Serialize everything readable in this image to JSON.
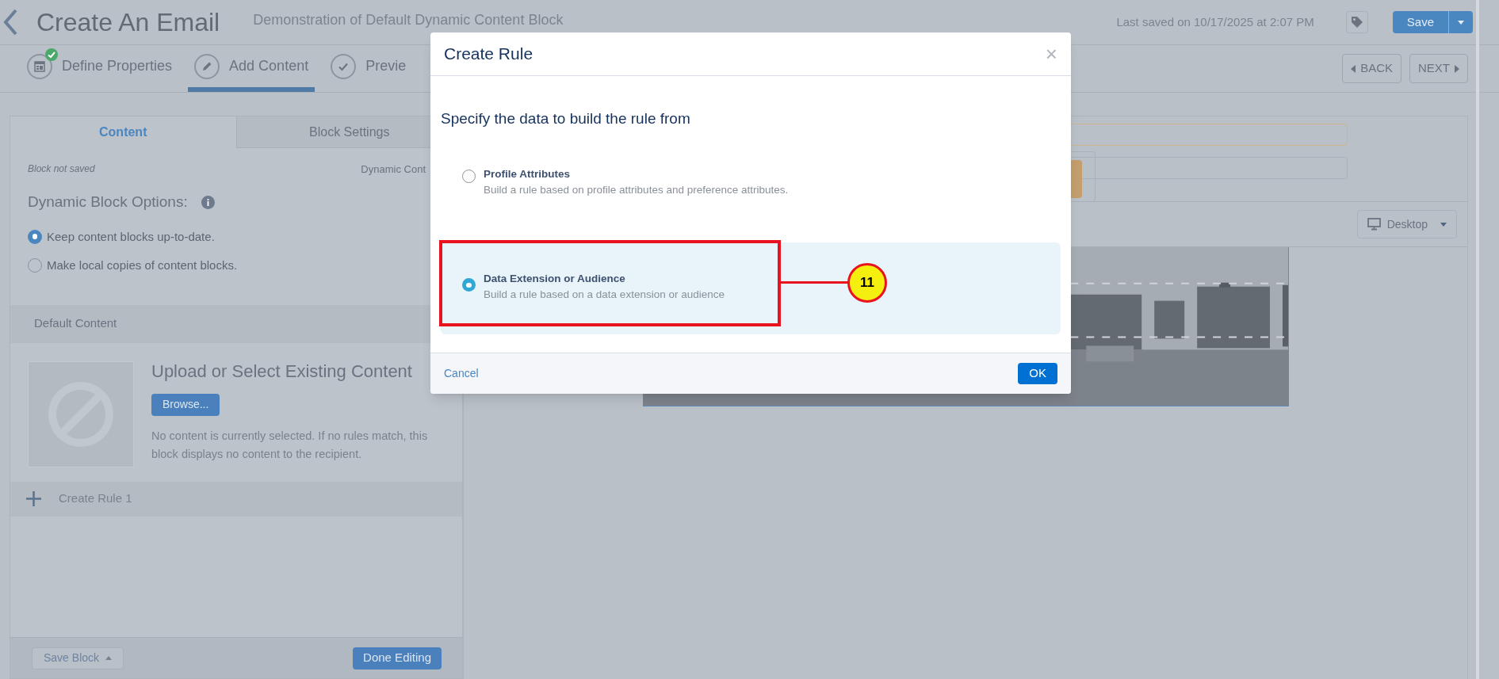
{
  "header": {
    "title": "Create An Email",
    "subtitle": "Demonstration of Default Dynamic Content Block",
    "last_saved": "Last saved on 10/17/2025 at 2:07 PM",
    "save": "Save"
  },
  "steps": [
    {
      "kind": "properties",
      "label": "Define Properties",
      "selected": false,
      "done": true
    },
    {
      "kind": "content",
      "label": "Add Content",
      "selected": true,
      "done": false
    },
    {
      "kind": "preview",
      "label": "Previe",
      "selected": false,
      "done": false
    }
  ],
  "nav": {
    "back": "BACK",
    "next": "NEXT"
  },
  "left_panel": {
    "tabs": [
      {
        "label": "Content",
        "selected": true
      },
      {
        "label": "Block Settings",
        "selected": false
      }
    ],
    "status": "Block not saved",
    "type_label": "Dynamic Cont",
    "options_title": "Dynamic Block Options:",
    "options": [
      {
        "label": "Keep content blocks up-to-date.",
        "selected": true
      },
      {
        "label": "Make local copies of content blocks.",
        "selected": false
      }
    ],
    "default_content": "Default Content",
    "upload_title": "Upload or Select Existing Content",
    "browse": "Browse...",
    "upload_note": "No content is currently selected. If no rules match, this block displays no content to the recipient.",
    "create_rule": "Create Rule 1",
    "save_block": "Save Block",
    "done_editing": "Done Editing"
  },
  "preview": {
    "device": "Desktop"
  },
  "modal": {
    "title": "Create Rule",
    "close": "×",
    "prompt": "Specify the data to build the rule from",
    "options": [
      {
        "title": "Profile Attributes",
        "description": "Build a rule based on profile attributes and preference attributes.",
        "selected": false
      },
      {
        "title": "Data Extension or Audience",
        "description": "Build a rule based on a data extension or audience",
        "selected": true
      }
    ],
    "cancel": "Cancel",
    "ok": "OK"
  },
  "annotation": {
    "label": "11"
  }
}
